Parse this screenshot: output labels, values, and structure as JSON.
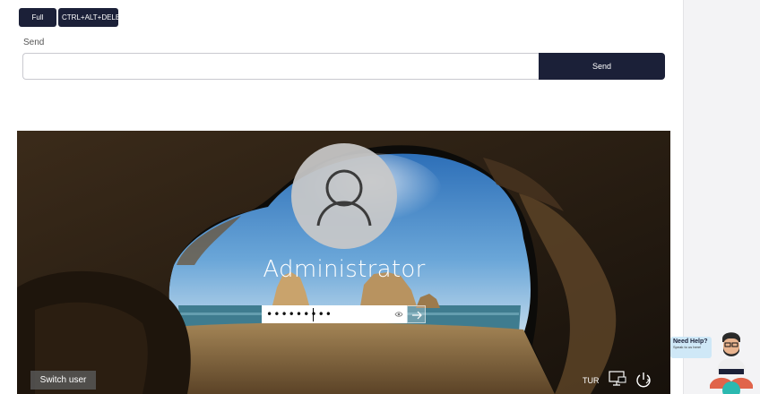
{
  "toolbar": {
    "fullscreen_label": "Full Screen",
    "cad_label": "CTRL+ALT+DELETE"
  },
  "send": {
    "label": "Send",
    "input_value": "",
    "button_label": "Send"
  },
  "login_screen": {
    "username": "Administrator",
    "password_masked": "•••••••••",
    "switch_user_label": "Switch user",
    "language": "TUR",
    "icons": [
      "user-silhouette-icon",
      "reveal-password-icon",
      "submit-arrow-icon",
      "network-icon",
      "power-icon"
    ]
  },
  "help_widget": {
    "title": "Need Help?",
    "subtitle": "Speak to us here!"
  },
  "colors": {
    "button_dark": "#1b2038",
    "panel_bg": "#ffffff",
    "page_bg": "#f3f3f5",
    "help_bubble": "#cfe8f7",
    "help_accent": "#2bb9b0"
  }
}
